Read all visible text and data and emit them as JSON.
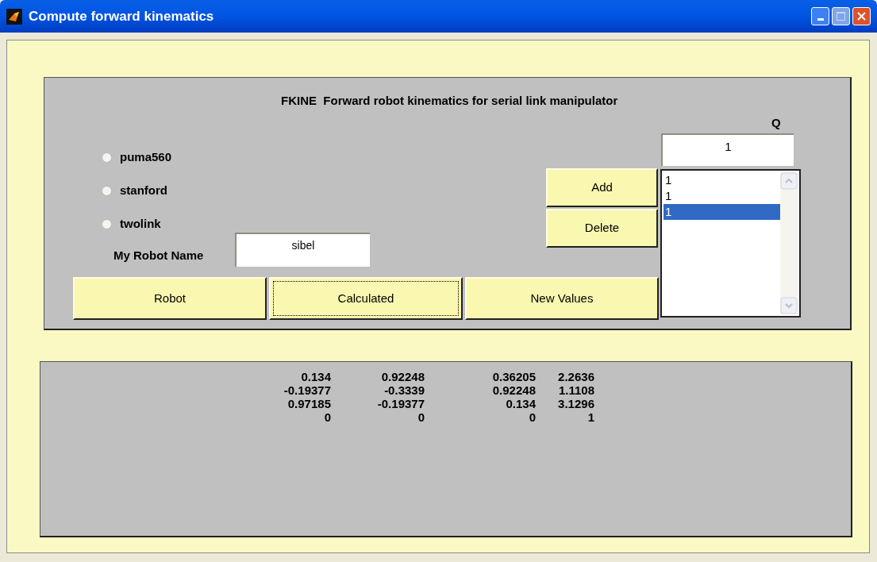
{
  "window": {
    "title": "Compute forward kinematics"
  },
  "header": "FKINE  Forward robot kinematics for serial link manipulator",
  "q_label": "Q",
  "q_field": {
    "value": "1"
  },
  "robots": [
    {
      "label": "puma560",
      "selected": false
    },
    {
      "label": "stanford",
      "selected": false
    },
    {
      "label": "twolink",
      "selected": false
    }
  ],
  "robot_name": {
    "label": "My Robot Name",
    "value": "sibel"
  },
  "add_button": "Add",
  "delete_button": "Delete",
  "q_list": [
    {
      "text": "1",
      "selected": false
    },
    {
      "text": "1",
      "selected": false
    },
    {
      "text": "1",
      "selected": true
    }
  ],
  "buttons": [
    {
      "label": "Robot",
      "focused": false
    },
    {
      "label": "Calculated",
      "focused": true
    },
    {
      "label": "New Values",
      "focused": false
    }
  ],
  "matrix": [
    [
      "0.134",
      "0.92248",
      "0.36205",
      "2.2636"
    ],
    [
      "-0.19377",
      "-0.3339",
      "0.92248",
      "1.1108"
    ],
    [
      "0.97185",
      "-0.19377",
      "0.134",
      "3.1296"
    ],
    [
      "0",
      "0",
      "0",
      "1"
    ]
  ]
}
